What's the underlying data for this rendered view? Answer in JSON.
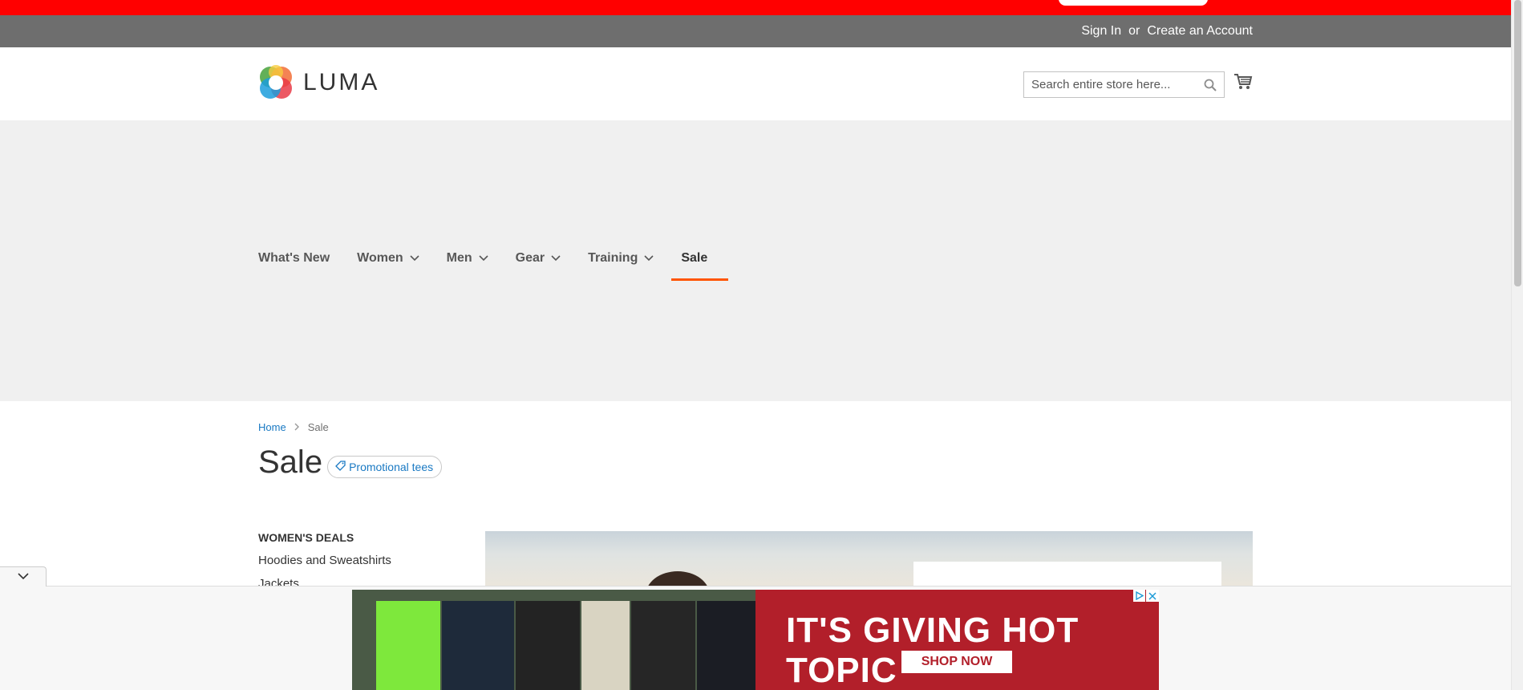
{
  "header": {
    "sign_in": "Sign In",
    "or": "or",
    "create_account": "Create an Account",
    "logo_text": "LUMA",
    "search_placeholder": "Search entire store here..."
  },
  "nav": {
    "items": [
      {
        "label": "What's New",
        "has_dropdown": false
      },
      {
        "label": "Women",
        "has_dropdown": true
      },
      {
        "label": "Men",
        "has_dropdown": true
      },
      {
        "label": "Gear",
        "has_dropdown": true
      },
      {
        "label": "Training",
        "has_dropdown": true
      },
      {
        "label": "Sale",
        "has_dropdown": false,
        "active": true
      }
    ]
  },
  "breadcrumb": {
    "home": "Home",
    "current": "Sale"
  },
  "page": {
    "title": "Sale",
    "tag": "Promotional tees"
  },
  "sidebar": {
    "heading": "WOMEN'S DEALS",
    "links": [
      "Hoodies and Sweatshirts",
      "Jackets"
    ]
  },
  "ad": {
    "headline": "IT'S GIVING HOT TOPIC",
    "cta": "SHOP NOW"
  },
  "colors": {
    "promo_strip": "#ff0000",
    "topbar": "#6e6e6e",
    "hero_bg": "#f0f0f0",
    "nav_active_underline": "#ff5501",
    "link_blue": "#1979c3",
    "ad_red": "#b21f2a"
  },
  "icons": {
    "search": "search-icon",
    "cart": "cart-icon",
    "tag": "tag-icon",
    "chevron": "chevron-down-icon",
    "adchoices": "adchoices-icon",
    "close": "close-icon"
  }
}
